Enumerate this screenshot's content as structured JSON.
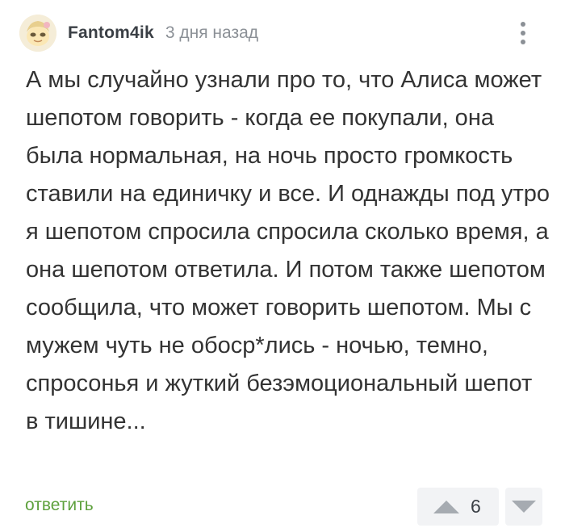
{
  "comment": {
    "author": "Fantom4ik",
    "time": "3 дня назад",
    "avatar_icon": "avatar-icon",
    "menu_icon": "more-vertical-icon",
    "text": "А мы случайно узнали про то, что Алиса может шепотом говорить - когда ее покупали, она была нормальная, на ночь просто громкость ставили на единичку и все. И однажды под утро я шепотом спросила спросила сколько время, а она шепотом ответила. И потом также шепотом сообщила, что может говорить шепотом. Мы с мужем чуть не обоср*лись - ночью, темно, спросонья и жуткий безэмоциональный шепот в тишине...",
    "reply_label": "ответить",
    "rating": "6",
    "upvote_icon": "triangle-up-icon",
    "downvote_icon": "triangle-down-icon"
  },
  "colors": {
    "text": "#333333",
    "muted": "#8b9096",
    "reply": "#5ea13d",
    "vote_bg": "#f2f3f5",
    "vote_icon": "#a6abb1"
  }
}
